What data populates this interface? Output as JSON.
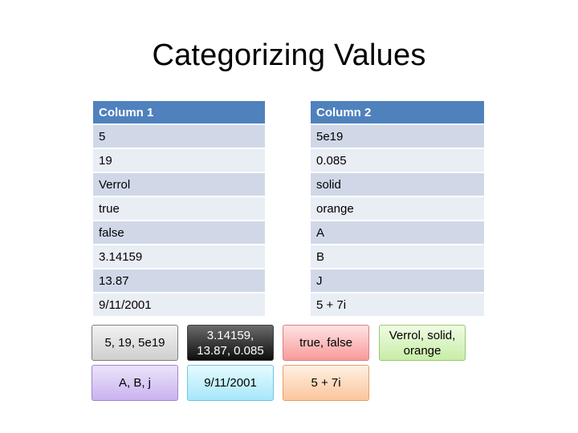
{
  "slide": {
    "title": "Categorizing Values"
  },
  "column1": {
    "header": "Column 1",
    "rows": [
      "5",
      "19",
      "Verrol",
      "true",
      "false",
      "3.14159",
      "13.87",
      "9/11/2001"
    ]
  },
  "column2": {
    "header": "Column 2",
    "rows": [
      "5e19",
      "0.085",
      "solid",
      "orange",
      "A",
      "B",
      "J",
      "5 + 7i"
    ]
  },
  "categories": [
    {
      "text": "5, 19, 5e19",
      "color": "#d9d9d9"
    },
    {
      "text": "3.14159, 13.87, 0.085",
      "color": "#262626"
    },
    {
      "text": "true, false",
      "color": "#fbb3b3"
    },
    {
      "text": "Verrol, solid, orange",
      "color": "#d7f2bf"
    },
    {
      "text": "A, B, j",
      "color": "#d6c6f4"
    },
    {
      "text": "9/11/2001",
      "color": "#bdeefc"
    },
    {
      "text": "5 + 7i",
      "color": "#fcd3b0"
    }
  ]
}
